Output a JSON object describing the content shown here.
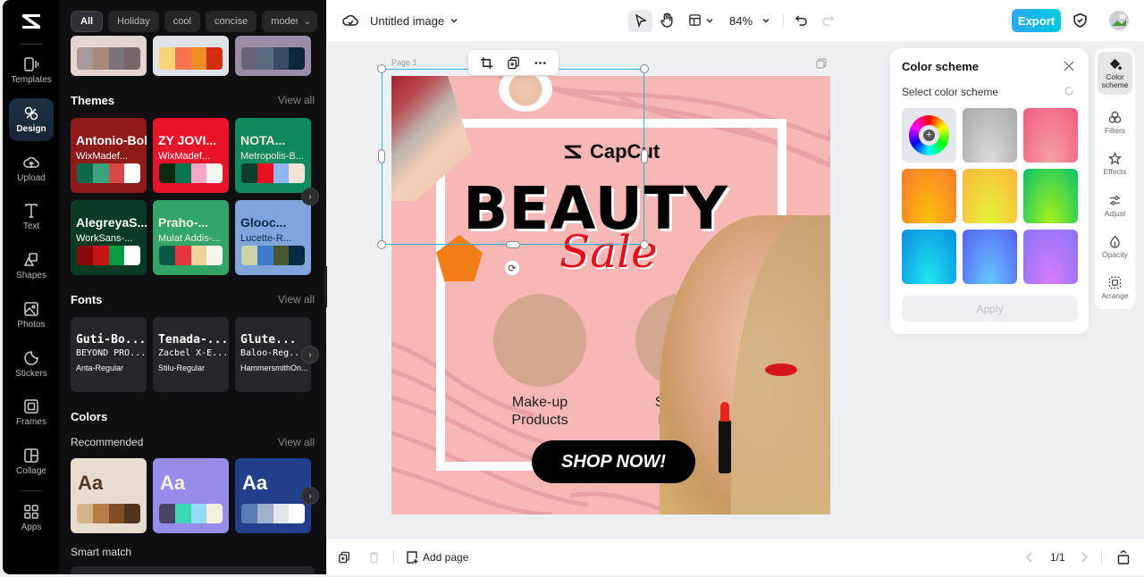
{
  "app": {
    "name": "CapCut"
  },
  "rail": {
    "items": [
      {
        "label": "Templates",
        "icon": "templates-icon"
      },
      {
        "label": "Design",
        "icon": "design-icon",
        "active": true
      },
      {
        "label": "Upload",
        "icon": "upload-icon"
      },
      {
        "label": "Text",
        "icon": "text-icon"
      },
      {
        "label": "Shapes",
        "icon": "shapes-icon"
      },
      {
        "label": "Photos",
        "icon": "photos-icon"
      },
      {
        "label": "Stickers",
        "icon": "stickers-icon"
      },
      {
        "label": "Frames",
        "icon": "frames-icon"
      },
      {
        "label": "Collage",
        "icon": "collage-icon"
      },
      {
        "label": "Apps",
        "icon": "apps-icon"
      }
    ]
  },
  "panel": {
    "chips": [
      "All",
      "Holiday",
      "cool",
      "concise",
      "modern"
    ],
    "top_palettes": [
      {
        "bg": "#e3d6d0",
        "colors": [
          "#a89a9a",
          "#a9877a",
          "#7b737c",
          "#7a6668"
        ]
      },
      {
        "bg": "#dfe3e8",
        "colors": [
          "#f8d477",
          "#fb7350",
          "#ef8d22",
          "#d42b13"
        ]
      },
      {
        "bg": "#9c8ca8",
        "colors": [
          "#6a6279",
          "#5c6a82",
          "#3b4a62",
          "#072a3a"
        ]
      }
    ],
    "themes": {
      "title": "Themes",
      "view_all": "View all",
      "cards": [
        {
          "t1": "Antonio-Bold",
          "t2": "WixMadef...",
          "bg": "#8e1a1a",
          "fg": "#ffffff",
          "colors": [
            "#0b6b4a",
            "#3aa57c",
            "#d94848",
            "#ffffff"
          ]
        },
        {
          "t1": "ZY JOVI...",
          "t2": "WixMadef...",
          "bg": "#e8142a",
          "fg": "#ffffff",
          "colors": [
            "#0b2a10",
            "#07764f",
            "#f7a6c8",
            "#f8f6ee"
          ]
        },
        {
          "t1": "NOTA...",
          "t2": "Metropolis-B...",
          "bg": "#0e8a5e",
          "fg": "#f6e6da",
          "colors": [
            "#0a3d2b",
            "#e8101e",
            "#8fb5f2",
            "#f3e3d9"
          ]
        },
        {
          "t1": "AlegreyaS...",
          "t2": "WorkSans-...",
          "bg": "#083b24",
          "fg": "#ffffff",
          "colors": [
            "#8a0a0a",
            "#c81414",
            "#0a9a43",
            "#ffffff"
          ]
        },
        {
          "t1": "Praho-...",
          "t2": "Mulat Addis-...",
          "bg": "#33a569",
          "fg": "#f6f1e1",
          "colors": [
            "#0b5a46",
            "#e8353e",
            "#ecd59c",
            "#f8f6ea"
          ]
        },
        {
          "t1": "Glooc...",
          "t2": "Lucette-R...",
          "bg": "#7ea6dc",
          "fg": "#0f2a48",
          "colors": [
            "#c8d4a8",
            "#3c7ccc",
            "#46562e",
            "#062a44"
          ]
        }
      ]
    },
    "fonts": {
      "title": "Fonts",
      "view_all": "View all",
      "cards": [
        {
          "t1": "Guti-Bo...",
          "t2": "BEYOND PRO...",
          "t3": "Anta-Regular"
        },
        {
          "t1": "Tenada-...",
          "t2": "Zacbel X-E...",
          "t3": "Stilu-Regular"
        },
        {
          "t1": "Glute...",
          "t2": "Baloo-Reg...",
          "t3": "HammersmithOn..."
        }
      ]
    },
    "colors": {
      "title": "Colors",
      "recommended": "Recommended",
      "view_all": "View all",
      "cards": [
        {
          "label": "Aa",
          "bg": "#e8dcd0",
          "fg": "#5a3620",
          "colors": [
            "#d6b488",
            "#b87b45",
            "#7f4e24",
            "#52331c"
          ]
        },
        {
          "label": "Aa",
          "bg": "#968cec",
          "fg": "#f6efdf",
          "colors": [
            "#4c4464",
            "#3cd8b2",
            "#92dcfa",
            "#f6f0de"
          ]
        },
        {
          "label": "Aa",
          "bg": "#233f8c",
          "fg": "#ffffff",
          "colors": [
            "#5a7cb4",
            "#9fb1cc",
            "#e3e6ea",
            "#ffffff"
          ]
        }
      ],
      "smart_match": "Smart match"
    }
  },
  "topbar": {
    "title": "Untitled image",
    "zoom": "84%",
    "export": "Export"
  },
  "canvas": {
    "page_label": "Page 1",
    "poster": {
      "brand": "CapCut",
      "headline": "BEAUTY",
      "subhead": "Sale",
      "product1": "Make-up\nProducts",
      "product1_l1": "Make-up",
      "product1_l2": "Products",
      "product2_l1": "Skin Care",
      "product2_l2": "Products",
      "cta": "SHOP NOW!"
    }
  },
  "color_scheme": {
    "title": "Color scheme",
    "subtitle": "Select color scheme",
    "apply": "Apply",
    "swatches": [
      {
        "type": "custom",
        "name": "color-wheel"
      },
      {
        "type": "gradient",
        "from": "#a8a8a8",
        "to": "#dcdcdc"
      },
      {
        "type": "gradient",
        "from": "#f25a82",
        "to": "#f5a3a0"
      },
      {
        "type": "gradient",
        "from": "#fb7a2c",
        "to": "#f8c20a"
      },
      {
        "type": "gradient",
        "from": "#fdb43b",
        "to": "#e4f63a"
      },
      {
        "type": "gradient",
        "from": "#0ac26a",
        "to": "#a9f21a"
      },
      {
        "type": "gradient",
        "from": "#0a8ee0",
        "to": "#20e8f0"
      },
      {
        "type": "gradient",
        "from": "#5560f5",
        "to": "#66c8ff"
      },
      {
        "type": "gradient",
        "from": "#8a74f8",
        "to": "#d77cfa"
      }
    ]
  },
  "right_tools": [
    {
      "label": "Color scheme",
      "active": true
    },
    {
      "label": "Filters"
    },
    {
      "label": "Effects"
    },
    {
      "label": "Adjust"
    },
    {
      "label": "Opacity"
    },
    {
      "label": "Arrange"
    }
  ],
  "bottombar": {
    "add_page": "Add page",
    "page_indicator": "1/1"
  }
}
